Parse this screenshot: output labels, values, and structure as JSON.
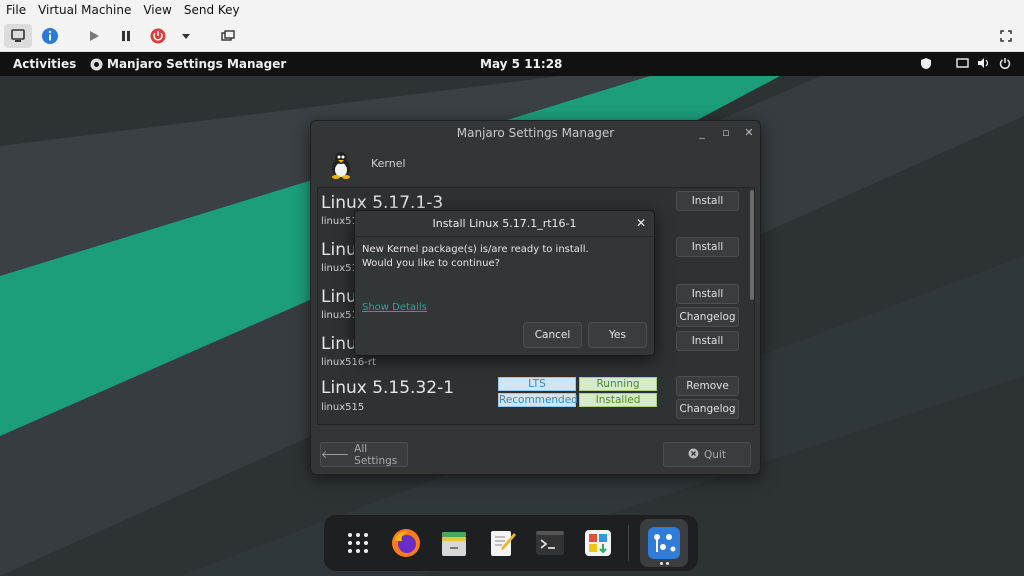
{
  "host_menu": [
    "File",
    "Virtual Machine",
    "View",
    "Send Key"
  ],
  "gnome_bar": {
    "activities": "Activities",
    "app_name": "Manjaro Settings Manager",
    "clock": "May 5  11:28"
  },
  "window": {
    "title": "Manjaro Settings Manager",
    "module": "Kernel",
    "kernels": [
      {
        "name": "Linux 5.17.1-3",
        "pkg": "linux517",
        "buttons": [
          "Install"
        ]
      },
      {
        "name": "Linux 5.17.1_rt16-1",
        "pkg": "linux517-rt",
        "buttons": [
          "Install"
        ]
      },
      {
        "name": "Linux 5.16.18-1",
        "pkg": "linux516",
        "buttons": [
          "Install",
          "Changelog"
        ]
      },
      {
        "name": "Linux 5.16.2_rt19-1",
        "pkg": "linux516-rt",
        "buttons": [
          "Install"
        ]
      },
      {
        "name": "Linux 5.15.32-1",
        "pkg": "linux515",
        "tags": [
          "LTS",
          "Running",
          "Recommended",
          "Installed"
        ],
        "buttons": [
          "Remove",
          "Changelog"
        ]
      }
    ],
    "all_settings": "All Settings",
    "quit": "Quit"
  },
  "dialog": {
    "title": "Install Linux 5.17.1_rt16-1",
    "line1": "New Kernel package(s) is/are ready to install.",
    "line2": "Would you like to continue?",
    "show_details": "Show Details",
    "cancel": "Cancel",
    "yes": "Yes"
  },
  "colors": {
    "accent_green": "#1b9f7b",
    "tag_blue": "#cfe6f7",
    "tag_green": "#d6ecc8",
    "link": "#26a59a"
  },
  "dock": [
    "app-grid-icon",
    "firefox-icon",
    "files-icon",
    "text-editor-icon",
    "terminal-icon",
    "software-icon",
    "settings-manager-icon"
  ]
}
